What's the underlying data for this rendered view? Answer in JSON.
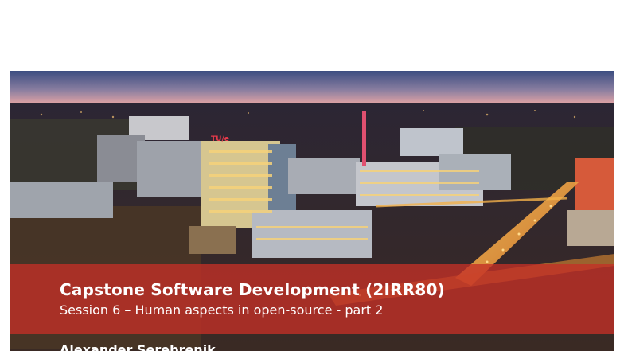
{
  "slide": {
    "title": "Capstone Software Development (2IRR80)",
    "subtitle": "Session 6 – Human aspects in open-source - part 2",
    "author_partial": "Alexander Serebrenik",
    "campus_sign": "TU/e"
  },
  "colors": {
    "title_band": "#c43026",
    "sky_top": "#3b4d80",
    "sky_horizon": "#d9a0a4",
    "city_lights": "#f2a640"
  }
}
